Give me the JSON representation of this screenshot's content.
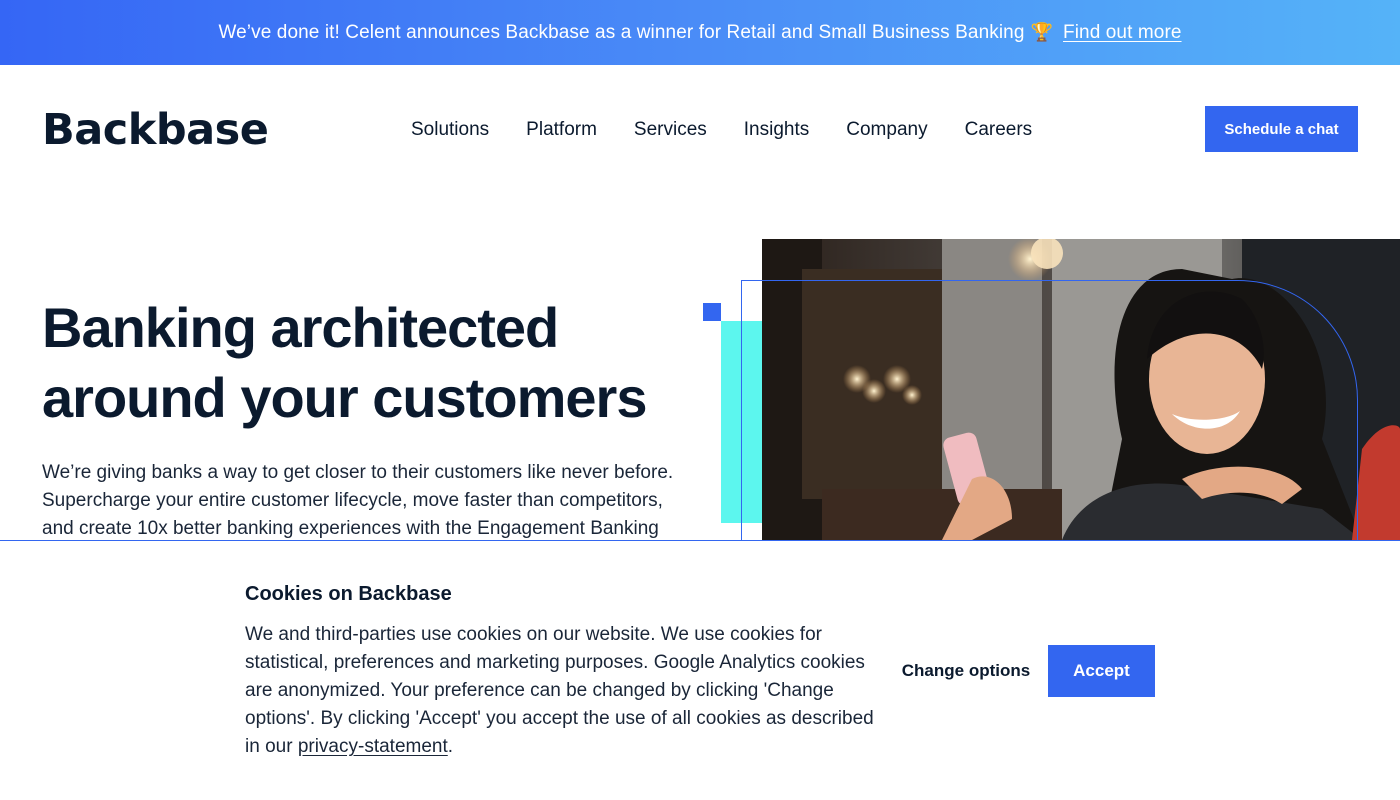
{
  "announcement": {
    "text": "We’ve done it! Celent announces Backbase as a winner for Retail and Small Business Banking",
    "icon": "trophy-icon",
    "link": "Find out more"
  },
  "header": {
    "logo": "Backbase",
    "nav": [
      "Solutions",
      "Platform",
      "Services",
      "Insights",
      "Company",
      "Careers"
    ],
    "cta": "Schedule a chat"
  },
  "hero": {
    "title_line1": "Banking architected",
    "title_line2": "around your customers",
    "description": "We’re giving banks a way to get closer to their customers like never before. Supercharge your entire customer lifecycle, move faster than competitors, and create 10x better banking experiences with the Engagement Banking"
  },
  "cookie": {
    "title": "Cookies on Backbase",
    "text": "We and third-parties use cookies on our website. We use cookies for statistical, preferences and marketing purposes. Google Analytics cookies are anonymized. Your preference can be changed by clicking 'Change options'. By clicking 'Accept' you accept the use of all cookies as described in our ",
    "link": "privacy-statement",
    "text_end": ".",
    "change_options": "Change options",
    "accept": "Accept"
  },
  "colors": {
    "brand_blue": "#3366f0",
    "accent_cyan": "#5cf6ee",
    "dark_text": "#0b1a2e"
  }
}
